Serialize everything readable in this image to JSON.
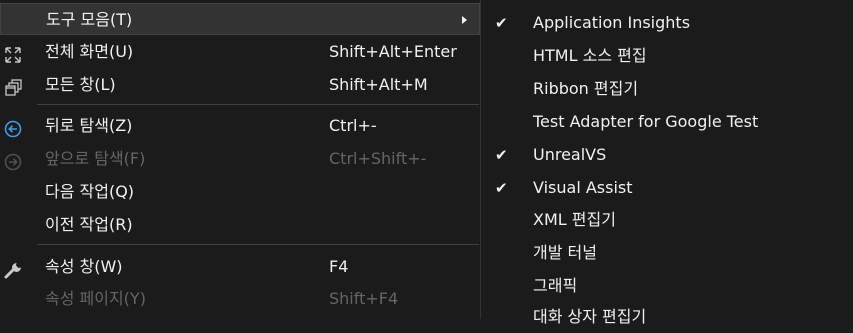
{
  "parent_menu": {
    "items": [
      {
        "label": "도구 모음(T)",
        "shortcut": ""
      },
      {
        "label": "전체 화면(U)",
        "shortcut": "Shift+Alt+Enter",
        "icon": "fullscreen-icon"
      },
      {
        "label": "모든 창(L)",
        "shortcut": "Shift+Alt+M",
        "icon": "all-windows-icon"
      },
      {
        "label": "뒤로 탐색(Z)",
        "shortcut": "Ctrl+-",
        "icon": "navigate-back-icon"
      },
      {
        "label": "앞으로 탐색(F)",
        "shortcut": "Ctrl+Shift+-",
        "icon": "navigate-forward-icon"
      },
      {
        "label": "다음 작업(Q)",
        "shortcut": ""
      },
      {
        "label": "이전 작업(R)",
        "shortcut": ""
      },
      {
        "label": "속성 창(W)",
        "shortcut": "F4",
        "icon": "wrench-icon"
      },
      {
        "label": "속성 페이지(Y)",
        "shortcut": "Shift+F4"
      }
    ]
  },
  "submenu": {
    "items": [
      {
        "label": "Application Insights",
        "checked": true
      },
      {
        "label": "HTML 소스 편집",
        "checked": false
      },
      {
        "label": "Ribbon 편집기",
        "checked": false
      },
      {
        "label": "Test Adapter for Google Test",
        "checked": false
      },
      {
        "label": "UnrealVS",
        "checked": true
      },
      {
        "label": "Visual Assist",
        "checked": true
      },
      {
        "label": "XML 편집기",
        "checked": false
      },
      {
        "label": "개발 터널",
        "checked": false
      },
      {
        "label": "그래픽",
        "checked": false
      },
      {
        "label": "대화 상자 편집기",
        "checked": false
      }
    ],
    "check_glyph": "✔"
  },
  "colors": {
    "background": "#1b1b1c",
    "highlight": "#333334",
    "text": "#f1f1f1",
    "disabled_text": "#656565",
    "accent_blue": "#3e9be9"
  }
}
